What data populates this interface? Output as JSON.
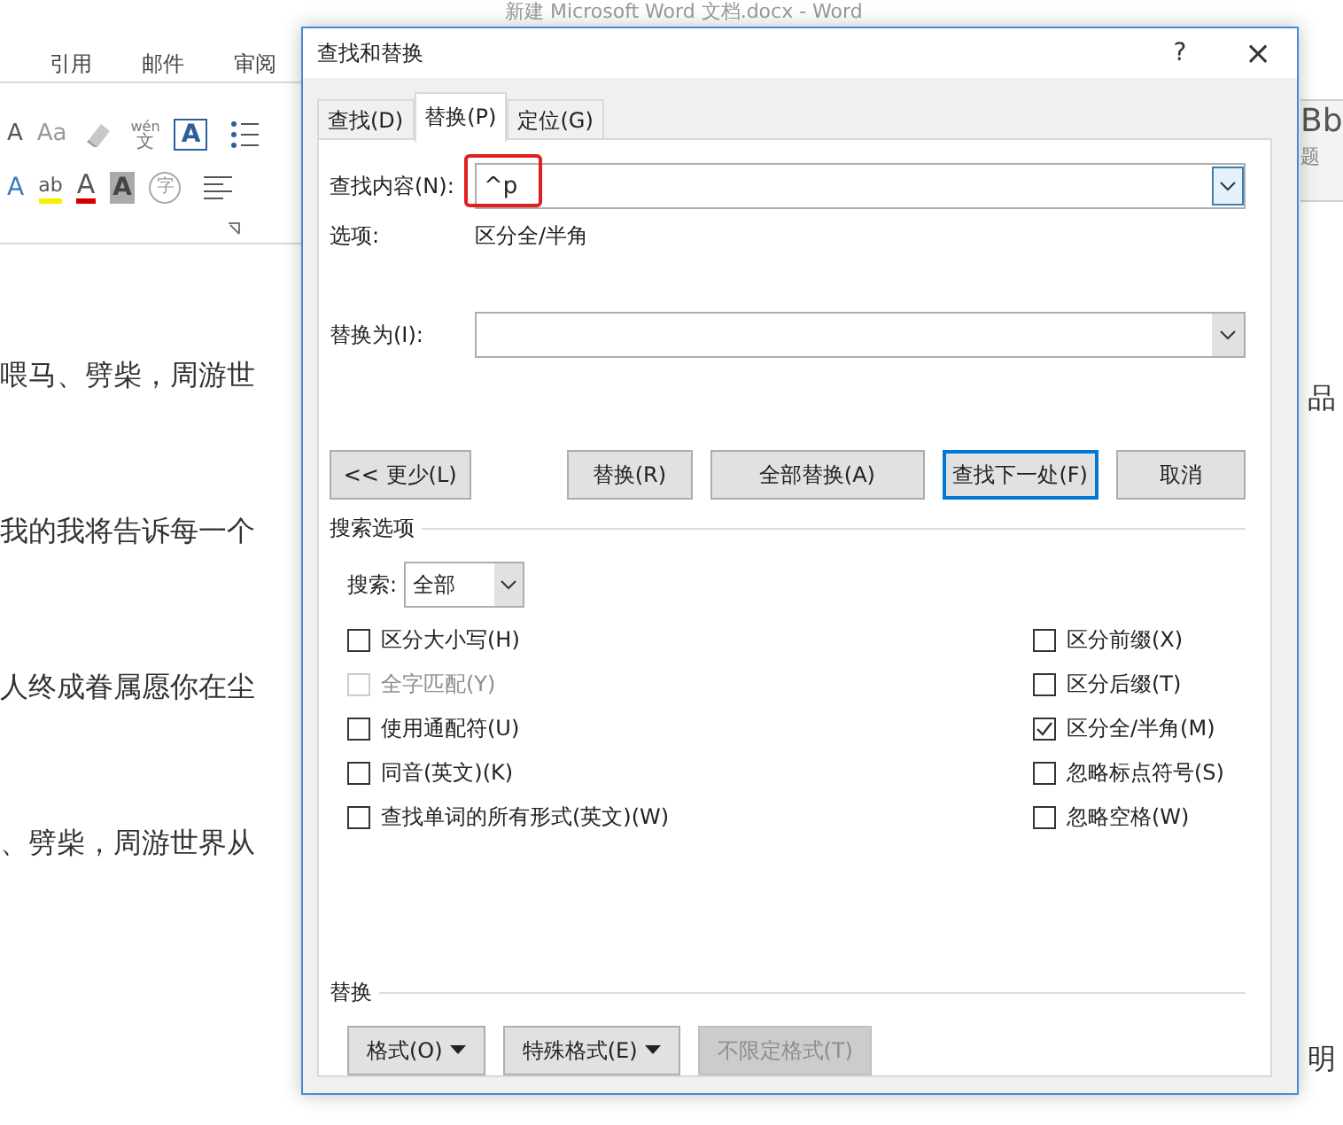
{
  "word": {
    "title": "新建 Microsoft Word 文档.docx - Word",
    "ribbon_tabs": [
      "引用",
      "邮件",
      "审阅"
    ],
    "ribbon_row_1": [
      {
        "kind": "grow",
        "text": "A"
      },
      {
        "kind": "case",
        "text": "Aa"
      },
      {
        "kind": "eraser"
      },
      {
        "kind": "phonetic",
        "text": "wén",
        "sub": "文"
      },
      {
        "kind": "boxed",
        "text": "A"
      },
      {
        "kind": "bullets"
      }
    ],
    "ribbon_row_2": [
      {
        "kind": "effect",
        "text": "A"
      },
      {
        "kind": "highlight",
        "text": "ab"
      },
      {
        "kind": "fontcolor",
        "text": "A"
      },
      {
        "kind": "shaded",
        "text": "A"
      },
      {
        "kind": "circled",
        "text": "字"
      },
      {
        "kind": "align"
      }
    ],
    "styles_gallery": {
      "sample": "Bb",
      "name": "题"
    },
    "document_lines": [
      "喂马、劈柴，周游世",
      "我的我将告诉每一个",
      "人终成眷属愿你在尘",
      "、劈柴，周游世界从"
    ],
    "document_right": [
      "品",
      "明"
    ]
  },
  "dialog": {
    "title": "查找和替换",
    "help": "?",
    "close": "×",
    "tabs": [
      {
        "label": "查找(D)",
        "selected": false
      },
      {
        "label": "替换(P)",
        "selected": true
      },
      {
        "label": "定位(G)",
        "selected": false
      }
    ],
    "find": {
      "label": "查找内容(N):",
      "value": "^p",
      "highlighted": true
    },
    "options": {
      "label": "选项:",
      "value": "区分全/半角"
    },
    "replace": {
      "label": "替换为(I):"
    },
    "buttons": [
      {
        "label": "<< 更少(L)",
        "default": false
      },
      {
        "label": "替换(R)",
        "default": false
      },
      {
        "label": "全部替换(A)",
        "default": false
      },
      {
        "label": "查找下一处(F)",
        "default": true
      },
      {
        "label": "取消",
        "default": false
      }
    ],
    "search_options": {
      "title": "搜索选项",
      "search_label": "搜索:",
      "search_value": "全部",
      "left": [
        {
          "label": "区分大小写(H)",
          "checked": false,
          "disabled": false
        },
        {
          "label": "全字匹配(Y)",
          "checked": false,
          "disabled": true
        },
        {
          "label": "使用通配符(U)",
          "checked": false,
          "disabled": false
        },
        {
          "label": "同音(英文)(K)",
          "checked": false,
          "disabled": false
        },
        {
          "label": "查找单词的所有形式(英文)(W)",
          "checked": false,
          "disabled": false
        }
      ],
      "right": [
        {
          "label": "区分前缀(X)",
          "checked": false,
          "disabled": false
        },
        {
          "label": "区分后缀(T)",
          "checked": false,
          "disabled": false
        },
        {
          "label": "区分全/半角(M)",
          "checked": true,
          "disabled": false
        },
        {
          "label": "忽略标点符号(S)",
          "checked": false,
          "disabled": false
        },
        {
          "label": "忽略空格(W)",
          "checked": false,
          "disabled": false
        }
      ]
    },
    "replace_section": {
      "title": "替换",
      "buttons": [
        {
          "label": "格式(O)",
          "menu": true,
          "disabled": false
        },
        {
          "label": "特殊格式(E)",
          "menu": true,
          "disabled": false
        },
        {
          "label": "不限定格式(T)",
          "menu": false,
          "disabled": true
        }
      ]
    }
  }
}
